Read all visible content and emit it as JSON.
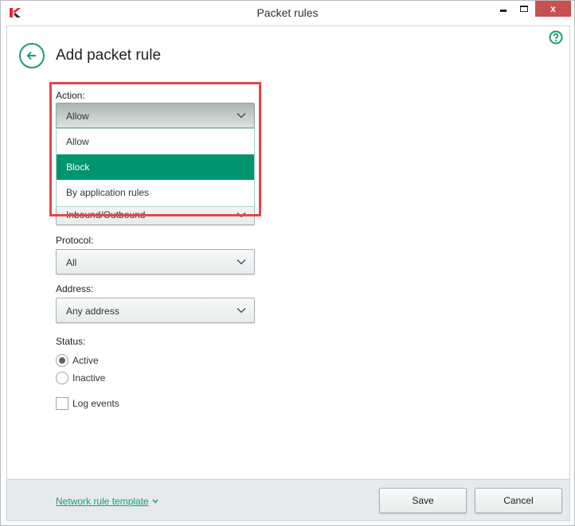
{
  "window": {
    "title": "Packet rules",
    "close_glyph": "x"
  },
  "page": {
    "title": "Add packet rule"
  },
  "form": {
    "action": {
      "label": "Action:",
      "value": "Allow",
      "options": [
        {
          "label": "Allow",
          "selected": false
        },
        {
          "label": "Block",
          "selected": true
        },
        {
          "label": "By application rules",
          "selected": false
        }
      ]
    },
    "direction": {
      "value": "Inbound/Outbound"
    },
    "protocol": {
      "label": "Protocol:",
      "value": "All"
    },
    "address": {
      "label": "Address:",
      "value": "Any address"
    },
    "status": {
      "label": "Status:",
      "options": [
        {
          "label": "Active",
          "checked": true
        },
        {
          "label": "Inactive",
          "checked": false
        }
      ]
    },
    "log_events": {
      "label": "Log events",
      "checked": false
    }
  },
  "footer": {
    "template_link": "Network rule template",
    "save_label": "Save",
    "cancel_label": "Cancel"
  },
  "colors": {
    "accent": "#009470",
    "link": "#1c9b76",
    "close_button": "#c75050",
    "highlight_box": "#e0484a"
  }
}
